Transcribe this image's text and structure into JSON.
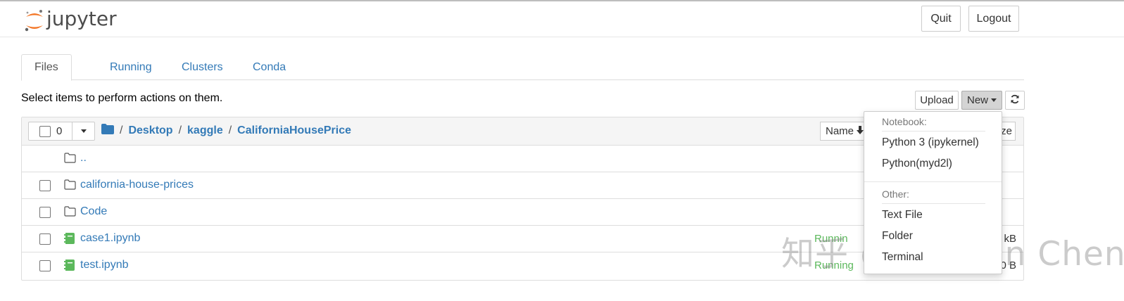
{
  "header": {
    "logo_text": "jupyter",
    "quit_label": "Quit",
    "logout_label": "Logout"
  },
  "tabs": [
    {
      "label": "Files",
      "active": true
    },
    {
      "label": "Running",
      "active": false
    },
    {
      "label": "Clusters",
      "active": false
    },
    {
      "label": "Conda",
      "active": false
    }
  ],
  "hint": "Select items to perform actions on them.",
  "toolbar": {
    "upload_label": "Upload",
    "new_label": "New"
  },
  "list_header": {
    "selected_count": "0",
    "breadcrumb": [
      "/",
      "Desktop",
      "/",
      "kaggle",
      "/",
      "CaliforniaHousePrice"
    ],
    "sort_label": "Name",
    "size_label": "ze"
  },
  "files": [
    {
      "name": "..",
      "type": "folder",
      "status": "",
      "size": ""
    },
    {
      "name": "california-house-prices",
      "type": "folder",
      "status": "",
      "size": ""
    },
    {
      "name": "Code",
      "type": "folder",
      "status": "",
      "size": ""
    },
    {
      "name": "case1.ipynb",
      "type": "notebook",
      "status": "Runnin",
      "size": "kB"
    },
    {
      "name": "test.ipynb",
      "type": "notebook",
      "status": "Running",
      "size": "0 B"
    }
  ],
  "new_menu": {
    "notebook_header": "Notebook:",
    "kernels": [
      "Python 3 (ipykernel)",
      "Python(myd2l)"
    ],
    "other_header": "Other:",
    "others": [
      "Text File",
      "Folder",
      "Terminal"
    ]
  },
  "watermark": "知乎 @Captain Chen",
  "colors": {
    "link": "#337ab7",
    "running": "#5cb85c",
    "notebook_icon": "#5cb85c",
    "logo_orange": "#f37626"
  }
}
